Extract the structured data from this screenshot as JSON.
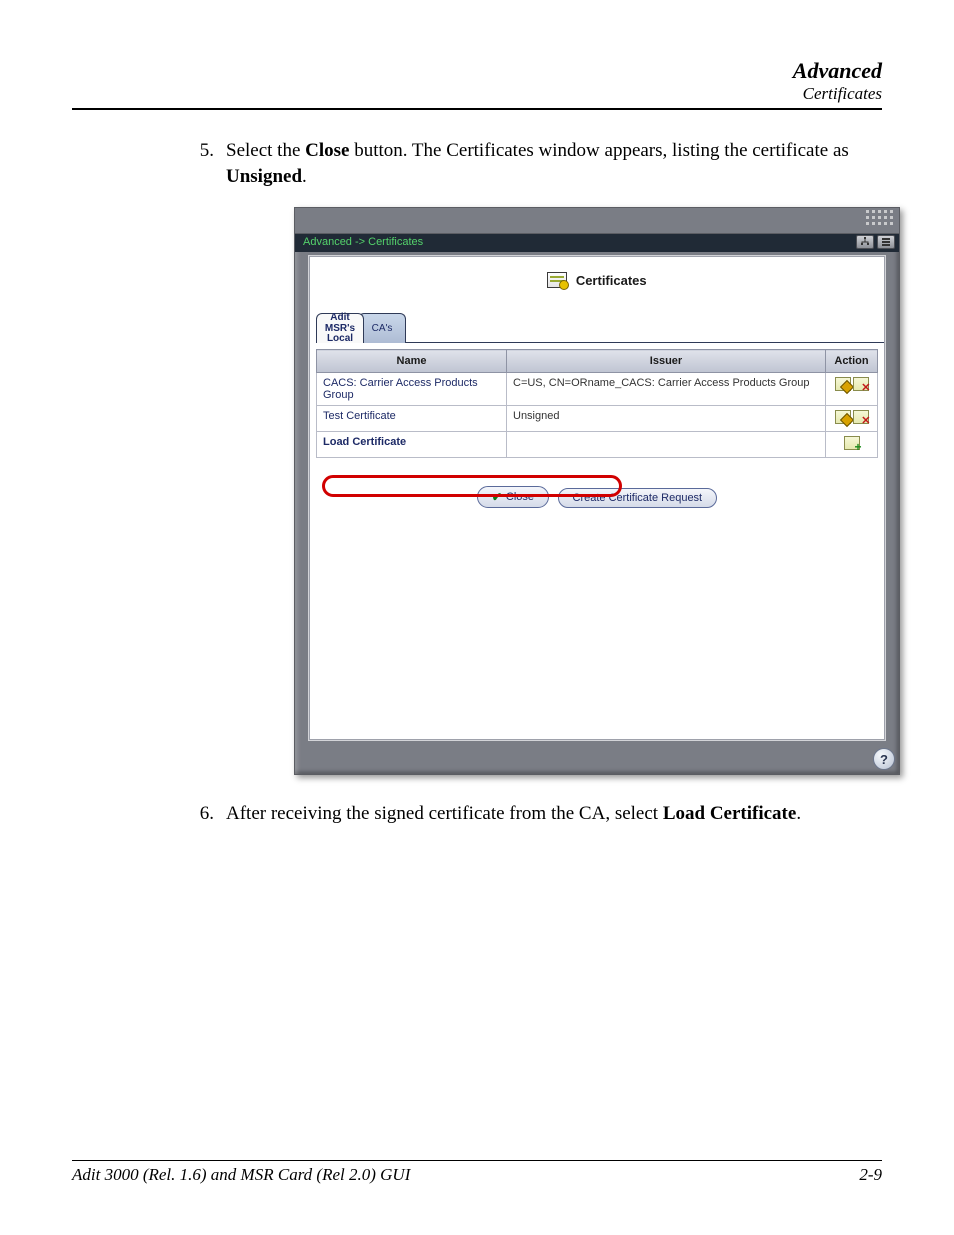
{
  "header": {
    "title": "Advanced",
    "subtitle": "Certificates"
  },
  "steps": {
    "s5": {
      "num": "5.",
      "pre": "Select the ",
      "b1": "Close",
      "mid": " button. The Certificates window appears, listing the certificate as ",
      "b2": "Unsigned",
      "post": "."
    },
    "s6": {
      "num": "6.",
      "pre": "After receiving the signed certificate from the CA, select ",
      "b1": "Load Certificate",
      "post": "."
    }
  },
  "window": {
    "breadcrumb": "Advanced -> Certificates",
    "title": "Certificates",
    "tabs": {
      "active": "Adit MSR's Local",
      "inactive": "CA's"
    },
    "columns": {
      "name": "Name",
      "issuer": "Issuer",
      "action": "Action"
    },
    "rows": [
      {
        "name": "CACS: Carrier Access Products Group",
        "issuer": "C=US, CN=ORname_CACS: Carrier Access Products Group",
        "actions": [
          "edit",
          "delete"
        ],
        "highlight": false
      },
      {
        "name": "Test Certificate",
        "issuer": "Unsigned",
        "actions": [
          "edit",
          "delete"
        ],
        "highlight": true
      },
      {
        "name": "Load Certificate",
        "issuer": "",
        "actions": [
          "load"
        ],
        "highlight": false
      }
    ],
    "buttons": {
      "close": "Close",
      "create": "Create Certificate Request"
    },
    "help": "?"
  },
  "footer": {
    "left": "Adit 3000 (Rel. 1.6) and MSR Card (Rel 2.0) GUI",
    "right": "2-9"
  }
}
